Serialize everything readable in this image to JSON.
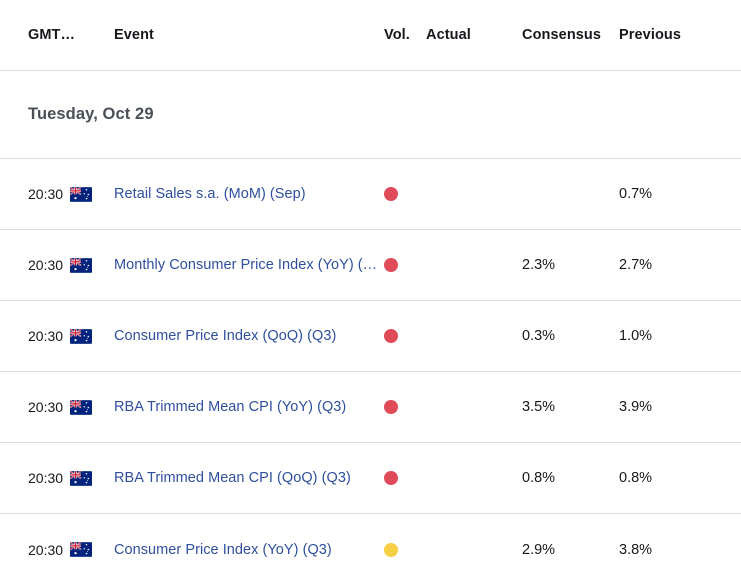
{
  "table": {
    "columns": {
      "time": "GMT…",
      "event": "Event",
      "volatility": "Vol.",
      "actual": "Actual",
      "consensus": "Consensus",
      "previous": "Previous"
    },
    "date_group": "Tuesday, Oct 29",
    "rows": [
      {
        "time": "20:30",
        "flag": "australia-flag-icon",
        "country": "Australia",
        "event": "Retail Sales s.a. (MoM) (Sep)",
        "volatility": "high",
        "volatility_icon": "volatility-dot-icon",
        "actual": "",
        "consensus": "",
        "previous": "0.7%"
      },
      {
        "time": "20:30",
        "flag": "australia-flag-icon",
        "country": "Australia",
        "event": "Monthly Consumer Price Index (YoY) (S…",
        "volatility": "high",
        "volatility_icon": "volatility-dot-icon",
        "actual": "",
        "consensus": "2.3%",
        "previous": "2.7%"
      },
      {
        "time": "20:30",
        "flag": "australia-flag-icon",
        "country": "Australia",
        "event": "Consumer Price Index (QoQ) (Q3)",
        "volatility": "high",
        "volatility_icon": "volatility-dot-icon",
        "actual": "",
        "consensus": "0.3%",
        "previous": "1.0%"
      },
      {
        "time": "20:30",
        "flag": "australia-flag-icon",
        "country": "Australia",
        "event": "RBA Trimmed Mean CPI (YoY) (Q3)",
        "volatility": "high",
        "volatility_icon": "volatility-dot-icon",
        "actual": "",
        "consensus": "3.5%",
        "previous": "3.9%"
      },
      {
        "time": "20:30",
        "flag": "australia-flag-icon",
        "country": "Australia",
        "event": "RBA Trimmed Mean CPI (QoQ) (Q3)",
        "volatility": "high",
        "volatility_icon": "volatility-dot-icon",
        "actual": "",
        "consensus": "0.8%",
        "previous": "0.8%"
      },
      {
        "time": "20:30",
        "flag": "australia-flag-icon",
        "country": "Australia",
        "event": "Consumer Price Index (YoY) (Q3)",
        "volatility": "medium",
        "volatility_icon": "volatility-dot-icon",
        "actual": "",
        "consensus": "2.9%",
        "previous": "3.8%"
      }
    ]
  },
  "colors": {
    "link": "#2f4f9e",
    "volatility_high": "#e04b5a",
    "volatility_medium": "#f5cf44",
    "divider": "#dcdcdc",
    "text": "#16181c",
    "date_header": "#4a4f58"
  }
}
